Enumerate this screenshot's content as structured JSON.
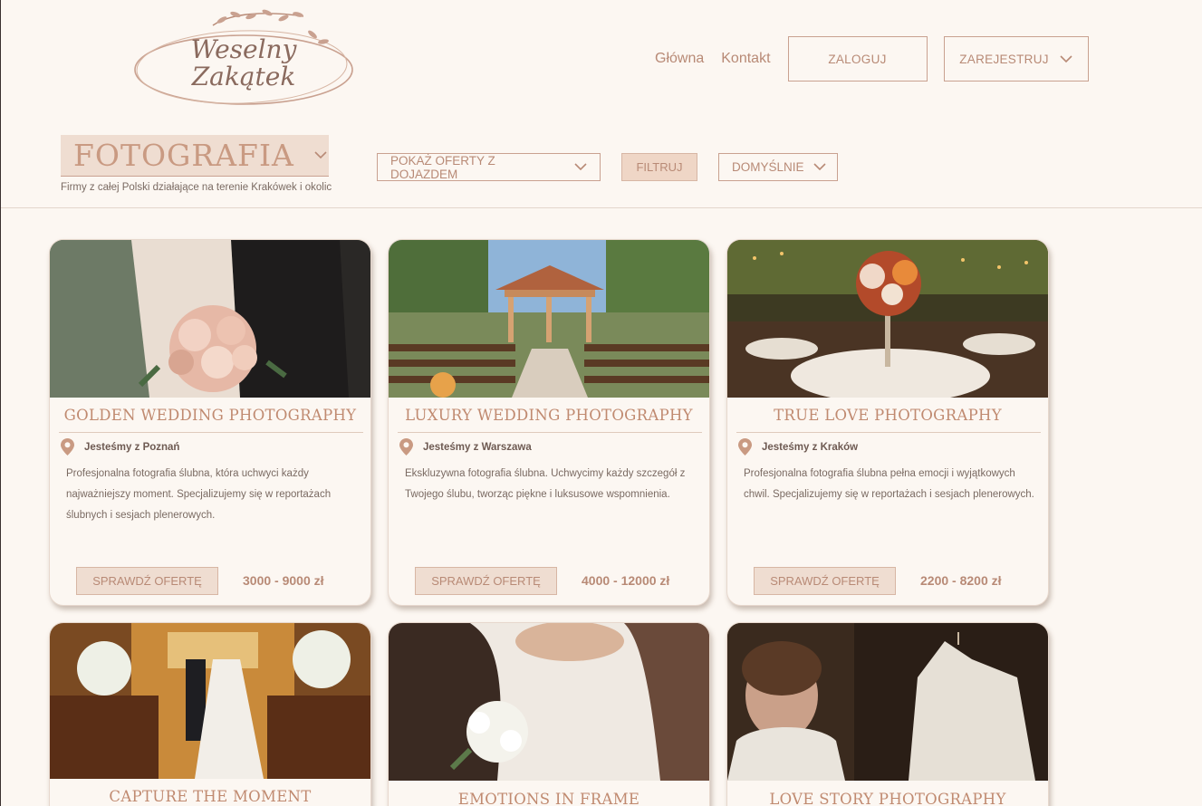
{
  "logo": {
    "line1": "Weselny",
    "line2": "Zakątek"
  },
  "nav": {
    "home": "Główna",
    "contact": "Kontakt",
    "login": "ZALOGUJ",
    "register": "ZAREJESTRUJ"
  },
  "filters": {
    "category": "FOTOGRAFIA",
    "subtitle": "Firmy z całej Polski działające na terenie Krakówek i okolic",
    "travel_select": "POKAŻ OFERTY Z DOJAZDEM",
    "filter_button": "FILTRUJ",
    "sort_select": "DOMYŚLNIE"
  },
  "colors": {
    "accent": "#c08a70",
    "background": "#fcf7f2",
    "button_bg": "#efddd1"
  },
  "cards": [
    {
      "title": "GOLDEN WEDDING PHOTOGRAPHY",
      "location": "Jesteśmy z Poznań",
      "description": "Profesjonalna fotografia ślubna, która uchwyci każdy najważniejszy moment. Specjalizujemy się w reportażach ślubnych i sesjach plenerowych.",
      "button": "SPRAWDŹ OFERTĘ",
      "price": "3000 - 9000 zł"
    },
    {
      "title": "LUXURY WEDDING PHOTOGRAPHY",
      "location": "Jesteśmy z Warszawa",
      "description": "Ekskluzywna fotografia ślubna. Uchwycimy każdy szczegół z Twojego ślubu, tworząc piękne i luksusowe wspomnienia.",
      "button": "SPRAWDŹ OFERTĘ",
      "price": "4000 - 12000 zł"
    },
    {
      "title": "TRUE LOVE PHOTOGRAPHY",
      "location": "Jesteśmy z Kraków",
      "description": "Profesjonalna fotografia ślubna pełna emocji i wyjątkowych chwil. Specjalizujemy się w reportażach i sesjach plenerowych.",
      "button": "SPRAWDŹ OFERTĘ",
      "price": "2200 - 8200 zł"
    },
    {
      "title": "CAPTURE THE MOMENT"
    },
    {
      "title": "EMOTIONS IN FRAME"
    },
    {
      "title": "LOVE STORY PHOTOGRAPHY"
    }
  ]
}
